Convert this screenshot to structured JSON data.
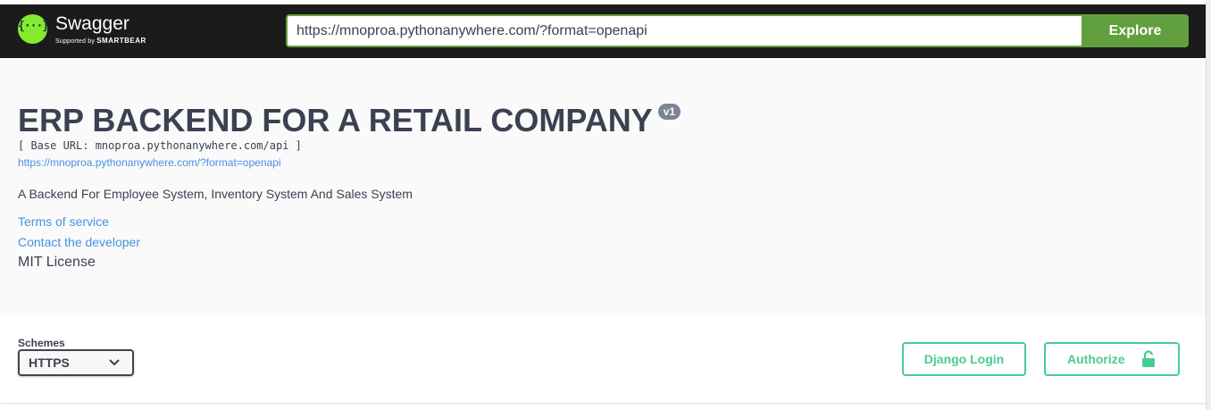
{
  "topbar": {
    "logo_title": "Swagger",
    "logo_supported_by": "Supported by",
    "logo_smartbear": "SMARTBEAR",
    "logo_icon_glyph": "{···}",
    "url_value": "https://mnoproa.pythonanywhere.com/?format=openapi",
    "explore_label": "Explore"
  },
  "info": {
    "title": "ERP BACKEND FOR A RETAIL COMPANY",
    "version": "v1",
    "base_url": "[ Base URL: mnoproa.pythonanywhere.com/api ]",
    "spec_link": "https://mnoproa.pythonanywhere.com/?format=openapi",
    "description": "A Backend For Employee System, Inventory System And Sales System",
    "terms_of_service": "Terms of service",
    "contact": "Contact the developer",
    "license": "MIT License"
  },
  "schemes": {
    "label": "Schemes",
    "selected": "HTTPS"
  },
  "actions": {
    "django_login": "Django Login",
    "authorize": "Authorize"
  },
  "colors": {
    "topbar_bg": "#1b1b1b",
    "brand_green": "#85ea2d",
    "explore_green": "#62a03f",
    "auth_green": "#49cc90",
    "link_blue": "#4990e2",
    "text_dark": "#3b4151",
    "badge_gray": "#7d8492"
  }
}
